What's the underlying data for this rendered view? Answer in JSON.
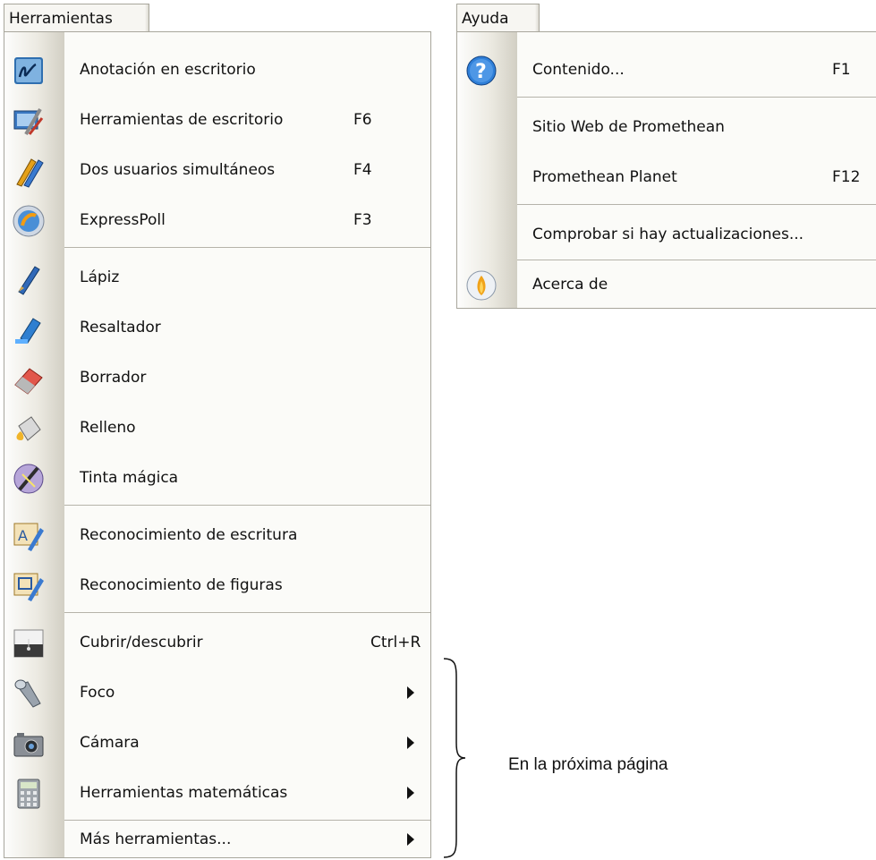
{
  "tools_menu": {
    "title": "Herramientas",
    "items": [
      {
        "label": "Anotación en escritorio",
        "shortcut": "",
        "submenu": false,
        "icon": "annotation-pen-icon"
      },
      {
        "label": "Herramientas de escritorio",
        "shortcut": "F6",
        "submenu": false,
        "icon": "desktop-tools-icon"
      },
      {
        "label": "Dos usuarios simultáneos",
        "shortcut": "F4",
        "submenu": false,
        "icon": "dual-pens-icon"
      },
      {
        "label": "ExpressPoll",
        "shortcut": "F3",
        "submenu": false,
        "icon": "expresspoll-icon"
      },
      {
        "label": "Lápiz",
        "shortcut": "",
        "submenu": false,
        "icon": "pen-icon"
      },
      {
        "label": "Resaltador",
        "shortcut": "",
        "submenu": false,
        "icon": "highlighter-icon"
      },
      {
        "label": "Borrador",
        "shortcut": "",
        "submenu": false,
        "icon": "eraser-icon"
      },
      {
        "label": "Relleno",
        "shortcut": "",
        "submenu": false,
        "icon": "fill-bucket-icon"
      },
      {
        "label": "Tinta mágica",
        "shortcut": "",
        "submenu": false,
        "icon": "magic-ink-icon"
      },
      {
        "label": "Reconocimiento de escritura",
        "shortcut": "",
        "submenu": false,
        "icon": "handwriting-recognition-icon"
      },
      {
        "label": "Reconocimiento de figuras",
        "shortcut": "",
        "submenu": false,
        "icon": "shape-recognition-icon"
      },
      {
        "label": "Cubrir/descubrir",
        "shortcut": "Ctrl+R",
        "submenu": false,
        "icon": "reveal-blind-icon"
      },
      {
        "label": "Foco",
        "shortcut": "",
        "submenu": true,
        "icon": "spotlight-icon"
      },
      {
        "label": "Cámara",
        "shortcut": "",
        "submenu": true,
        "icon": "camera-icon"
      },
      {
        "label": "Herramientas matemáticas",
        "shortcut": "",
        "submenu": true,
        "icon": "calculator-icon"
      },
      {
        "label": "Más herramientas...",
        "shortcut": "",
        "submenu": true,
        "icon": ""
      }
    ]
  },
  "help_menu": {
    "title": "Ayuda",
    "items": [
      {
        "label": "Contenido...",
        "shortcut": "F1",
        "icon": "help-question-icon"
      },
      {
        "label": "Sitio Web de Promethean",
        "shortcut": "",
        "icon": ""
      },
      {
        "label": "Promethean Planet",
        "shortcut": "F12",
        "icon": ""
      },
      {
        "label": "Comprobar si hay actualizaciones...",
        "shortcut": "",
        "icon": ""
      },
      {
        "label": "Acerca de",
        "shortcut": "",
        "icon": "promethean-logo-icon"
      }
    ]
  },
  "annotation": {
    "text": "En la próxima página"
  }
}
